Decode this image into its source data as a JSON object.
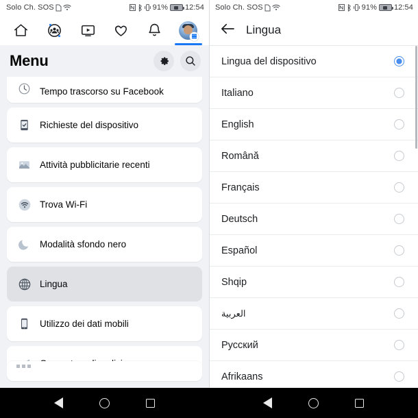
{
  "status_bar": {
    "carrier": "Solo Ch. SOS",
    "sim_icon": "sim-card-icon",
    "wifi_icon": "wifi-icon",
    "nfc_icon": "nfc-icon",
    "bluetooth_icon": "bluetooth-icon",
    "vibrate_icon": "vibrate-icon",
    "battery_percent": "91%",
    "battery_icon": "battery-charging-icon",
    "time": "12:54"
  },
  "left_panel": {
    "tabs": [
      {
        "name": "home",
        "icon": "home-icon",
        "active": false
      },
      {
        "name": "groups",
        "icon": "groups-icon",
        "active": false
      },
      {
        "name": "watch",
        "icon": "video-play-icon",
        "active": false
      },
      {
        "name": "dating",
        "icon": "hearts-icon",
        "active": false
      },
      {
        "name": "notifications",
        "icon": "bell-icon",
        "active": false
      },
      {
        "name": "menu",
        "icon": "avatar-menu-icon",
        "active": true
      }
    ],
    "header": {
      "title": "Menu",
      "settings_icon": "gear-icon",
      "search_icon": "search-icon"
    },
    "items": [
      {
        "label": "Tempo trascorso su Facebook",
        "icon": "clock-icon",
        "selected": false,
        "partial": true
      },
      {
        "label": "Richieste del dispositivo",
        "icon": "device-requests-icon",
        "selected": false,
        "partial": false
      },
      {
        "label": "Attività pubblicitarie recenti",
        "icon": "ads-activity-icon",
        "selected": false,
        "partial": false
      },
      {
        "label": "Trova Wi-Fi",
        "icon": "wifi-icon",
        "selected": false,
        "partial": false
      },
      {
        "label": "Modalità sfondo nero",
        "icon": "moon-icon",
        "selected": false,
        "partial": false
      },
      {
        "label": "Lingua",
        "icon": "globe-icon",
        "selected": true,
        "partial": false
      },
      {
        "label": "Utilizzo dei dati mobili",
        "icon": "phone-icon",
        "selected": false,
        "partial": false
      },
      {
        "label": "Generatore di codici",
        "icon": "key-icon",
        "selected": false,
        "partial": false
      }
    ]
  },
  "right_panel": {
    "header": {
      "back_icon": "back-arrow-icon",
      "title": "Lingua"
    },
    "languages": [
      {
        "label": "Lingua del dispositivo",
        "selected": true,
        "rtl": false
      },
      {
        "label": "Italiano",
        "selected": false,
        "rtl": false
      },
      {
        "label": "English",
        "selected": false,
        "rtl": false
      },
      {
        "label": "Română",
        "selected": false,
        "rtl": false
      },
      {
        "label": "Français",
        "selected": false,
        "rtl": false
      },
      {
        "label": "Deutsch",
        "selected": false,
        "rtl": false
      },
      {
        "label": "Español",
        "selected": false,
        "rtl": false
      },
      {
        "label": "Shqip",
        "selected": false,
        "rtl": false
      },
      {
        "label": "العربية",
        "selected": false,
        "rtl": true
      },
      {
        "label": "Русский",
        "selected": false,
        "rtl": false
      },
      {
        "label": "Afrikaans",
        "selected": false,
        "rtl": false
      }
    ]
  },
  "android_nav": {
    "back_icon": "back-triangle-icon",
    "home_icon": "home-circle-icon",
    "recents_icon": "recents-square-icon"
  },
  "colors": {
    "accent": "#1877f2",
    "radio_on": "#4a8ef0",
    "panel_bg": "#f0f2f5",
    "card_bg": "#ffffff",
    "selected_card_bg": "#dfe1e5"
  }
}
